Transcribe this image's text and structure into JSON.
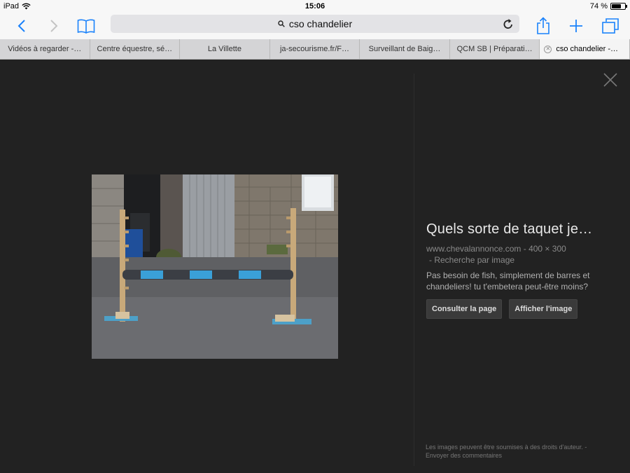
{
  "status": {
    "device": "iPad",
    "time": "15:06",
    "battery": "74 %",
    "battery_level": 0.74
  },
  "toolbar": {
    "url_text": "cso chandelier",
    "accent_color": "#1a82fb"
  },
  "tabs": [
    {
      "label": "Vidéos à regarder -…"
    },
    {
      "label": "Centre équestre, sé…"
    },
    {
      "label": "La Villette"
    },
    {
      "label": "ja-secourisme.fr/F…"
    },
    {
      "label": "Surveillant de Baig…"
    },
    {
      "label": "QCM SB | Préparati…"
    },
    {
      "label": "cso chandelier -…",
      "active": true
    }
  ],
  "result": {
    "title": "Quels sorte de taquet je…",
    "domain": "www.chevalannonce.com",
    "size": "- 400 × 300",
    "search_by_image": "- Recherche par image",
    "description": "Pas besoin de fish, simplement de barres et chandeliers! tu t'embetera peut-être moins?",
    "visit_button": "Consulter la page",
    "view_button": "Afficher l'image"
  },
  "footer": {
    "rights_text": "Les images peuvent être soumises à des droits d'auteur.",
    "feedback_link": "- Envoyer des commentaires"
  }
}
